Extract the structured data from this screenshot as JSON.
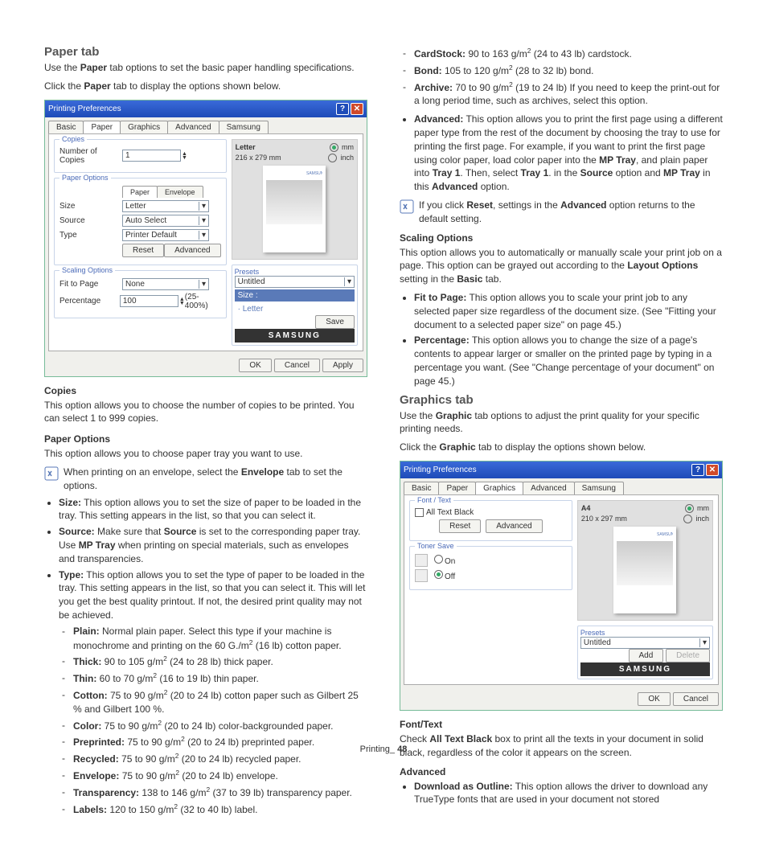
{
  "h": {
    "paperTab": "Paper tab",
    "copies": "Copies",
    "paperOpt": "Paper Options",
    "graphTab": "Graphics tab",
    "fontText": "Font/Text",
    "scaling": "Scaling Options",
    "advanced": "Advanced"
  },
  "t": {
    "pt1": "Use the ",
    "pt2": " tab options to set the basic paper handling specifications.",
    "pt3": "Click the ",
    "pt4": " tab to display the options shown below.",
    "copies": "This option allows you to choose the number of copies to be printed. You can select 1 to 999 copies.",
    "po1": "This option allows you to choose paper tray you want to use.",
    "note1": "When printing on an envelope, select the ",
    "note1b": " tab to set the options.",
    "size": " This option allows you to set the size of paper to be loaded in the tray. This setting appears in the list, so that you can select it.",
    "src1": " Make sure that ",
    "src2": " is set to the corresponding paper tray.",
    "src3": "Use ",
    "src4": " when printing on special materials, such as envelopes and transparencies.",
    "type": " This option allows you to set the type of paper to be loaded in the tray. This setting appears in the list, so that you can select it. This will let you get the best quality printout. If not, the desired print quality may not be achieved.",
    "plain": " Normal plain paper. Select this type if your machine is monochrome and printing on the 60 G./m",
    "plain2": " (16 lb) cotton paper.",
    "thick": " 90 to 105 g/m",
    "thick2": " (24 to 28 lb) thick paper.",
    "thin": " 60 to 70 g/m",
    "thin2": " (16 to 19 lb) thin paper.",
    "cotton": " 75 to 90 g/m",
    "cotton2": " (20 to 24 lb) cotton paper such as Gilbert 25 % and Gilbert 100 %.",
    "color": " 75 to 90 g/m",
    "color2": " (20 to 24 lb) color-backgrounded paper.",
    "prep": " 75 to 90 g/m",
    "prep2": " (20 to 24 lb) preprinted paper.",
    "rec": " 75 to 90 g/m",
    "rec2": " (20 to 24 lb) recycled paper.",
    "env": " 75 to 90 g/m",
    "env2": " (20 to 24 lb) envelope.",
    "trans": " 138 to 146 g/m",
    "trans2": " (37 to 39 lb) transparency paper.",
    "lab": " 120 to 150 g/m",
    "lab2": " (32 to 40 lb) label.",
    "card": " 90 to 163 g/m",
    "card2": " (24 to 43 lb) cardstock.",
    "bond": " 105 to 120 g/m",
    "bond2": " (28 to 32 lb) bond.",
    "arch": " 70 to 90 g/m",
    "arch2": " (19 to 24 lb) If you need to keep the print-out for a long period time, such as archives, select this option.",
    "adv1": " This option allows you to print the first page using a different paper type from the rest of the document by choosing the tray to use for printing the first page. For example, if you want to print the first page using color paper, load color paper into the ",
    "adv2": ", and plain paper into ",
    "adv3": ". Then, select ",
    "adv4": ". in the ",
    "adv5": " option and ",
    "adv6": " in this ",
    "adv7": " option.",
    "note2a": "If you click ",
    "note2b": ", settings in the ",
    "note2c": " option returns to the default setting.",
    "so1": "This option allows you to automatically or manually scale your print job on a page. This option can be grayed out according to the ",
    "so2": " setting in the ",
    "so3": " tab.",
    "fit": " This option allows you to scale your print job to any selected paper size regardless of the document size. (See \"Fitting your document to a selected paper size\" on page 45.)",
    "pct": " This option allows you to change the size of a page's contents to appear larger or smaller on the printed page by typing in a percentage you want. (See \"Change percentage of your document\" on page 45.)",
    "gt1": "Use the ",
    "gt2": " tab options to adjust the print quality for your specific printing needs.",
    "gt3": "Click the ",
    "gt4": " tab to display the options shown below.",
    "ft1": "Check ",
    "ft2": " box to print all the texts in your document in solid black, regardless of the color it appears on the screen.",
    "dl": " This option allows the driver to download any TrueType fonts that are used in your document not stored"
  },
  "b": {
    "Paper": "Paper",
    "Envelope": "Envelope",
    "Source": "Source",
    "MPTray": "MP Tray",
    "Size": "Size:",
    "Src": "Source:",
    "Type": "Type:",
    "Plain": "Plain:",
    "Thick": "Thick:",
    "Thin": "Thin:",
    "Cotton": "Cotton:",
    "Color": "Color:",
    "Preprinted": "Preprinted:",
    "Recycled": "Recycled:",
    "Env": "Envelope:",
    "Trans": "Transparency:",
    "Labels": "Labels:",
    "CardStock": "CardStock:",
    "Bond": "Bond:",
    "Archive": "Archive:",
    "Advanced": "Advanced:",
    "Reset": "Reset",
    "Tray1": "Tray 1",
    "LayoutOpt": "Layout Options",
    "Basic": "Basic",
    "FitPage": "Fit to Page:",
    "Pct": "Percentage:",
    "Graphic": "Graphic",
    "AllTextBlack": "All Text Black",
    "DownloadOutline": "Download as Outline:"
  },
  "d1": {
    "title": "Printing Preferences",
    "tabs": [
      "Basic",
      "Paper",
      "Graphics",
      "Advanced",
      "Samsung"
    ],
    "copies": "Copies",
    "numCopies": "Number of Copies",
    "val": "1",
    "paperOpt": "Paper Options",
    "ptabs": [
      "Paper",
      "Envelope"
    ],
    "size": "Size",
    "sizeV": "Letter",
    "src": "Source",
    "srcV": "Auto Select",
    "type": "Type",
    "typeV": "Printer Default",
    "reset": "Reset",
    "adv": "Advanced",
    "scal": "Scaling Options",
    "fit": "Fit to Page",
    "fitV": "None",
    "pct": "Percentage",
    "pctV": "100",
    "pctR": "(25-400%)",
    "pvSize": "Letter",
    "pvDim": "216 x 279 mm",
    "mm": "mm",
    "inch": "inch",
    "presets": "Presets",
    "preV": "Untitled",
    "sizeL": "Size :",
    "letterL": "· Letter",
    "save": "Save",
    "brand": "SAMSUNG",
    "ok": "OK",
    "cancel": "Cancel",
    "apply": "Apply"
  },
  "d2": {
    "title": "Printing Preferences",
    "tabs": [
      "Basic",
      "Paper",
      "Graphics",
      "Advanced",
      "Samsung"
    ],
    "font": "Font / Text",
    "atb": "All Text Black",
    "reset": "Reset",
    "adv": "Advanced",
    "toner": "Toner Save",
    "on": "On",
    "off": "Off",
    "pvSize": "A4",
    "pvDim": "210 x 297 mm",
    "mm": "mm",
    "inch": "inch",
    "presets": "Presets",
    "preV": "Untitled",
    "add": "Add",
    "del": "Delete",
    "brand": "SAMSUNG",
    "ok": "OK",
    "cancel": "Cancel"
  },
  "footer": {
    "sec": "Printing",
    "pg": "48"
  }
}
